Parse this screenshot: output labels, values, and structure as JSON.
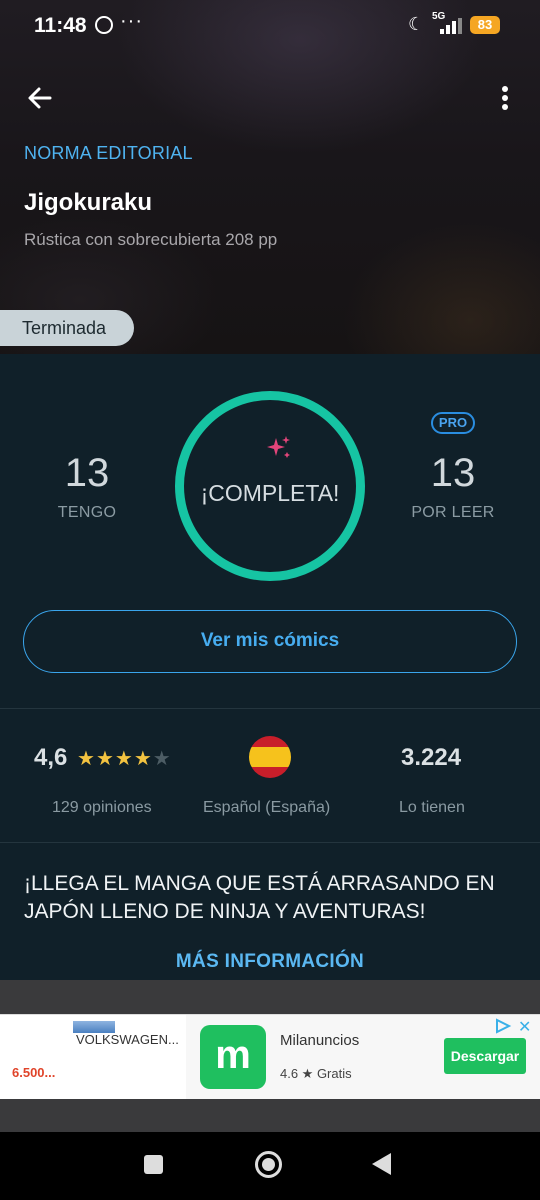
{
  "status_bar": {
    "time": "11:48",
    "more_dots": "···",
    "network": "5G",
    "battery": "83"
  },
  "header": {
    "publisher": "NORMA EDITORIAL",
    "title": "Jigokuraku",
    "subtitle": "Rústica con sobrecubierta 208 pp",
    "status_chip": "Terminada"
  },
  "collection": {
    "owned_count": "13",
    "owned_label": "TENGO",
    "progress_label": "¡COMPLETA!",
    "to_read_count": "13",
    "to_read_label": "POR LEER",
    "pro_badge": "PRO",
    "view_button": "Ver mis cómics"
  },
  "stats": {
    "rating": "4,6",
    "rating_stars": 4,
    "rating_label": "129 opiniones",
    "language_label": "Español (España)",
    "owners": "3.224",
    "owners_label": "Lo tienen"
  },
  "description": {
    "promo": "¡LLEGA EL MANGA QUE ESTÁ ARRASANDO EN JAPÓN LLENO DE NINJA Y AVENTURAS!",
    "more_info": "MÁS INFORMACIÓN"
  },
  "ad": {
    "car_title": "VOLKSWAGEN...",
    "price": "6.500...",
    "app_icon_letter": "m",
    "app_name": "Milanuncios",
    "app_rating": "4.6 ★  Gratis",
    "download_button": "Descargar",
    "close": "✕"
  },
  "colors": {
    "accent_blue": "#4fb3f0",
    "ring_teal": "#16c4a3",
    "panel_bg": "#102029",
    "star": "#f3c340",
    "ad_green": "#1fbf5f"
  }
}
